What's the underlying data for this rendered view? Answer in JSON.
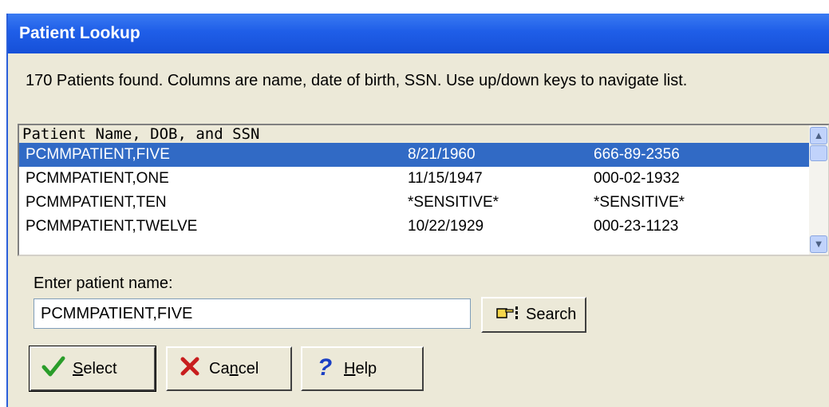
{
  "window": {
    "title": "Patient Lookup"
  },
  "info_text": "170 Patients found. Columns are name, date of birth, SSN. Use up/down keys to navigate list.",
  "list": {
    "header": "Patient Name, DOB, and SSN",
    "rows": [
      {
        "name": "PCMMPATIENT,FIVE",
        "dob": "8/21/1960",
        "ssn": "666-89-2356",
        "selected": true
      },
      {
        "name": "PCMMPATIENT,ONE",
        "dob": "11/15/1947",
        "ssn": "000-02-1932",
        "selected": false
      },
      {
        "name": "PCMMPATIENT,TEN",
        "dob": "*SENSITIVE*",
        "ssn": "*SENSITIVE*",
        "selected": false
      },
      {
        "name": "PCMMPATIENT,TWELVE",
        "dob": "10/22/1929",
        "ssn": "000-23-1123",
        "selected": false
      }
    ]
  },
  "entry": {
    "label": "Enter patient name:",
    "value": "PCMMPATIENT,FIVE"
  },
  "buttons": {
    "search": {
      "label": "Search",
      "icon": "pointing-hand-icon"
    },
    "select": {
      "pre": "",
      "u": "S",
      "post": "elect",
      "icon": "checkmark-icon"
    },
    "cancel": {
      "pre": "Ca",
      "u": "n",
      "post": "cel",
      "icon": "x-icon"
    },
    "help": {
      "pre": "",
      "u": "H",
      "post": "elp",
      "icon": "question-icon"
    }
  },
  "colors": {
    "title_bar": "#1f5ee8",
    "selection": "#316ac5",
    "check": "#2a9d2a",
    "cancel_x": "#c81e1e",
    "help_q": "#1a3fc4"
  }
}
